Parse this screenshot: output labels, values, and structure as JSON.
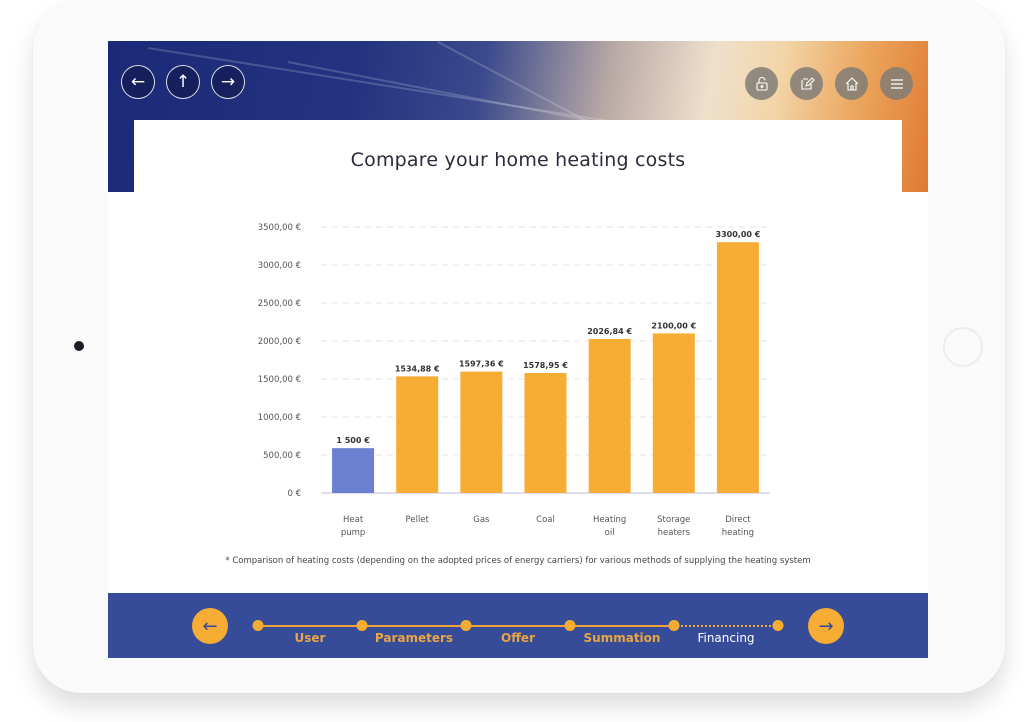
{
  "nav": {
    "back_icon": "arrow-left-icon",
    "up_icon": "arrow-up-icon",
    "forward_icon": "arrow-right-icon"
  },
  "tools": [
    {
      "name": "unlock",
      "icon": "unlock-icon"
    },
    {
      "name": "edit",
      "icon": "edit-note-icon"
    },
    {
      "name": "home",
      "icon": "home-icon"
    },
    {
      "name": "menu",
      "icon": "hamburger-menu-icon"
    }
  ],
  "page": {
    "title": "Compare your home heating costs",
    "footnote": "* Comparison of heating costs (depending on the adopted prices of energy carriers) for various methods of supplying the heating system"
  },
  "colors": {
    "highlight_bar": "#6b80d1",
    "default_bar": "#f7ad33",
    "footer_bg": "#374c98",
    "accent": "#f7ad33"
  },
  "chart_data": {
    "type": "bar",
    "title": "Compare your home heating costs",
    "xlabel": "",
    "ylabel": "",
    "ylim": [
      0,
      3500
    ],
    "grid": true,
    "yticks": [
      0,
      500,
      1000,
      1500,
      2000,
      2500,
      3000,
      3500
    ],
    "ytick_labels": [
      "0 €",
      "500,00 €",
      "1000,00 €",
      "1500,00 €",
      "2000,00 €",
      "2500,00 €",
      "3000,00 €",
      "3500,00 €"
    ],
    "categories": [
      [
        "Heat",
        "pump"
      ],
      [
        "Pellet"
      ],
      [
        "Gas"
      ],
      [
        "Coal"
      ],
      [
        "Heating",
        "oil"
      ],
      [
        "Storage",
        "heaters"
      ],
      [
        "Direct",
        "heating"
      ]
    ],
    "values": [
      590,
      1534.88,
      1597.36,
      1578.95,
      2026.84,
      2100.0,
      3300.0
    ],
    "data_labels": [
      "1 500 €",
      "1534,88 €",
      "1597,36 €",
      "1578,95 €",
      "2026,84 €",
      "2100,00 €",
      "3300,00 €"
    ],
    "highlight_index": 0
  },
  "footer": {
    "prev_icon": "arrow-left-icon",
    "next_icon": "arrow-right-icon",
    "steps": [
      {
        "label": "User",
        "active": false
      },
      {
        "label": "Parameters",
        "active": false
      },
      {
        "label": "Offer",
        "active": false
      },
      {
        "label": "Summation",
        "active": false
      },
      {
        "label": "Financing",
        "active": true
      }
    ]
  }
}
